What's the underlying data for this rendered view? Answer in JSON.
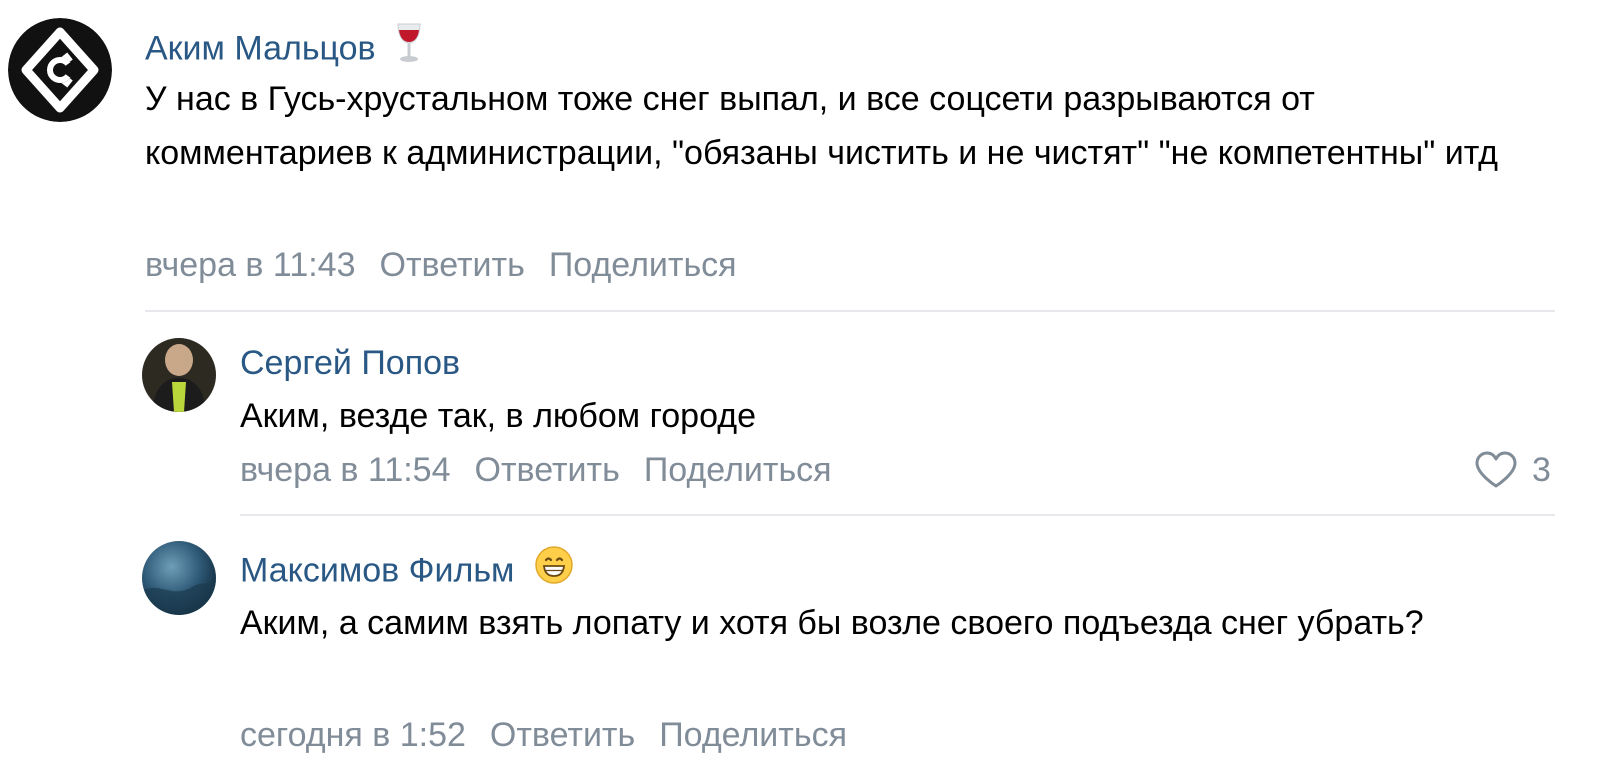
{
  "comments": [
    {
      "author": "Аким Мальцов",
      "emoji": "wine-glass-icon",
      "text": "У нас в Гусь-хрустальном тоже снег выпал, и все соцсети разрываются от комментариев к администрации, \"обязаны чистить и не чистят\" \"не компетентны\" итд",
      "date": "вчера в 11:43",
      "reply_label": "Ответить",
      "share_label": "Поделиться"
    },
    {
      "author": "Сергей Попов",
      "text": "Аким, везде так, в любом городе",
      "date": "вчера в 11:54",
      "reply_label": "Ответить",
      "share_label": "Поделиться",
      "likes": "3"
    },
    {
      "author": "Максимов Фильм",
      "emoji": "grinning-face-icon",
      "text": "Аким, а самим взять лопату и хотя бы возле своего подъезда снег убрать?",
      "date": "сегодня в 1:52",
      "reply_label": "Ответить",
      "share_label": "Поделиться"
    }
  ],
  "colors": {
    "author": "#2a5885",
    "meta": "#818c99",
    "text": "#000000",
    "separator": "#e7e8ec"
  }
}
